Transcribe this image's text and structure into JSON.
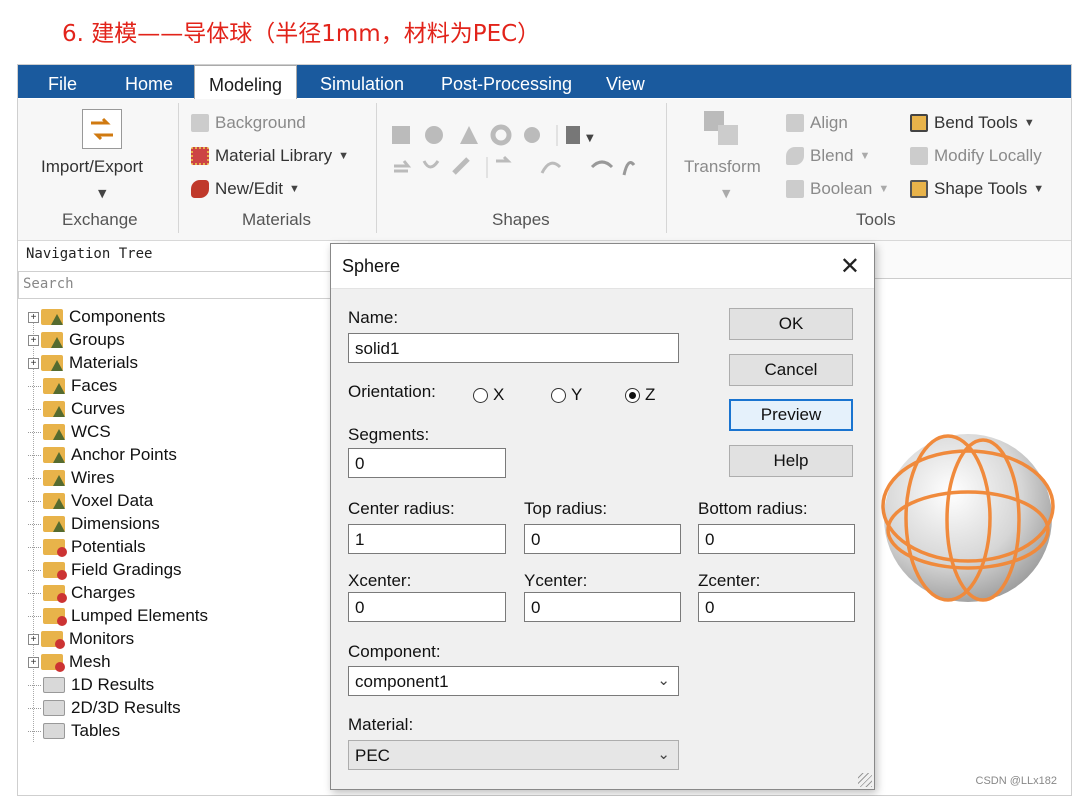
{
  "heading": "6. 建模——导体球（半径1mm，材料为PEC）",
  "menu": {
    "tabs": [
      {
        "label": "File"
      },
      {
        "label": "Home"
      },
      {
        "label": "Modeling"
      },
      {
        "label": "Simulation"
      },
      {
        "label": "Post-Processing"
      },
      {
        "label": "View"
      }
    ]
  },
  "ribbon": {
    "exchange": {
      "import_export": "Import/Export",
      "group": "Exchange"
    },
    "materials": {
      "background": "Background",
      "material_library": "Material Library",
      "new_edit": "New/Edit",
      "group": "Materials"
    },
    "shapes": {
      "group": "Shapes"
    },
    "tools": {
      "transform": "Transform",
      "align": "Align",
      "blend": "Blend",
      "boolean": "Boolean",
      "bend_tools": "Bend Tools",
      "modify_locally": "Modify Locally",
      "shape_tools": "Shape Tools",
      "group": "Tools"
    }
  },
  "nav": {
    "title": "Navigation Tree",
    "search_placeholder": "Search",
    "items": [
      {
        "label": "Components"
      },
      {
        "label": "Groups"
      },
      {
        "label": "Materials"
      },
      {
        "label": "Faces"
      },
      {
        "label": "Curves"
      },
      {
        "label": "WCS"
      },
      {
        "label": "Anchor Points"
      },
      {
        "label": "Wires"
      },
      {
        "label": "Voxel Data"
      },
      {
        "label": "Dimensions"
      },
      {
        "label": "Potentials"
      },
      {
        "label": "Field Gradings"
      },
      {
        "label": "Charges"
      },
      {
        "label": "Lumped Elements"
      },
      {
        "label": "Monitors"
      },
      {
        "label": "Mesh"
      },
      {
        "label": "1D Results"
      },
      {
        "label": "2D/3D Results"
      },
      {
        "label": "Tables"
      }
    ]
  },
  "dialog": {
    "title": "Sphere",
    "name_label": "Name:",
    "name_value": "solid1",
    "orientation_label": "Orientation:",
    "orient_x": "X",
    "orient_y": "Y",
    "orient_z": "Z",
    "orientation_selected": "Z",
    "segments_label": "Segments:",
    "segments_value": "0",
    "center_radius_label": "Center radius:",
    "center_radius_value": "1",
    "top_radius_label": "Top radius:",
    "top_radius_value": "0",
    "bottom_radius_label": "Bottom radius:",
    "bottom_radius_value": "0",
    "xcenter_label": "Xcenter:",
    "xcenter_value": "0",
    "ycenter_label": "Ycenter:",
    "ycenter_value": "0",
    "zcenter_label": "Zcenter:",
    "zcenter_value": "0",
    "component_label": "Component:",
    "component_value": "component1",
    "material_label": "Material:",
    "material_value": "PEC",
    "ok": "OK",
    "cancel": "Cancel",
    "preview": "Preview",
    "help": "Help"
  },
  "watermark": "CSDN @LLx182",
  "colors": {
    "menubar": "#1a5a9e",
    "heading": "#e2231a",
    "sphere_wire": "#f08a3c",
    "focus": "#1a74d0"
  }
}
